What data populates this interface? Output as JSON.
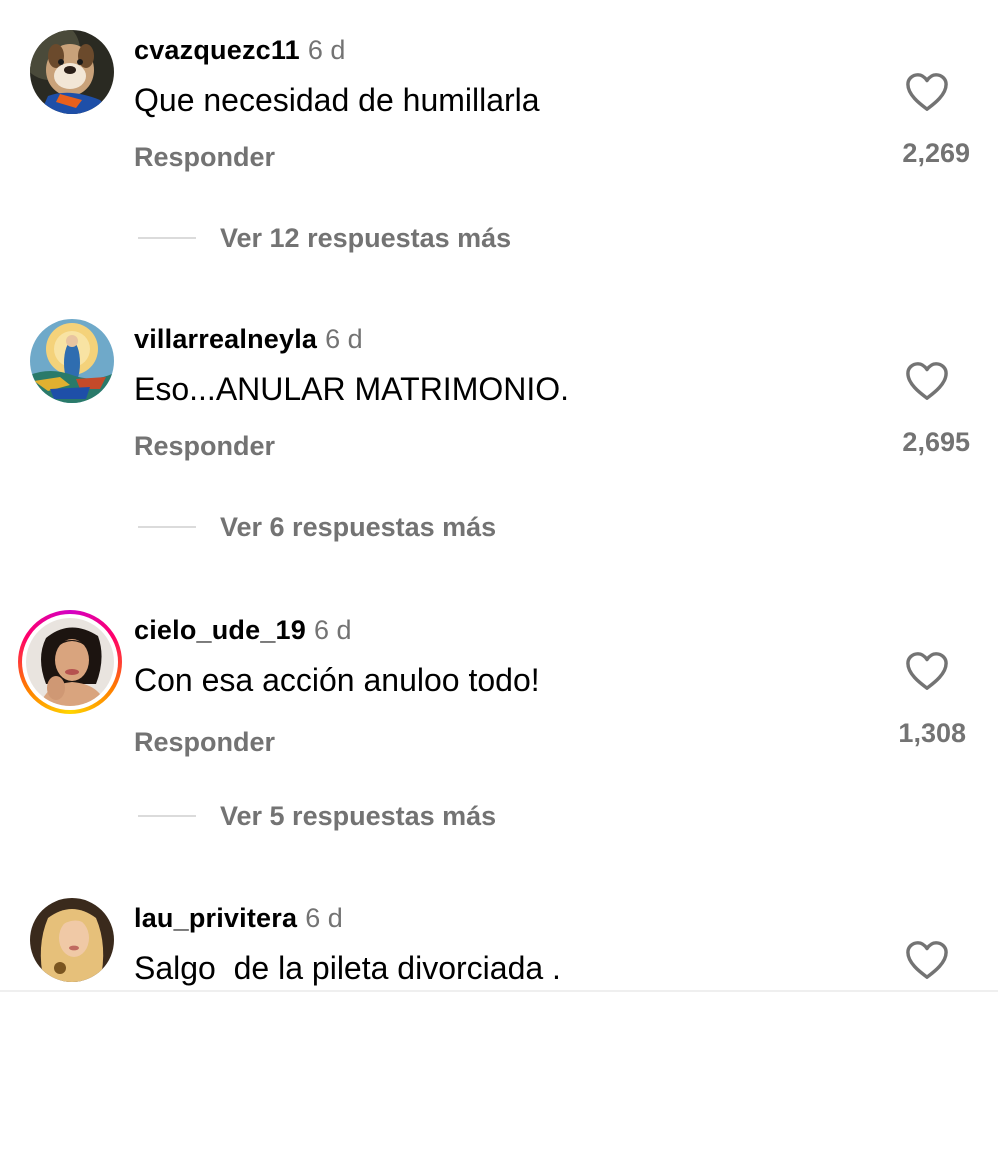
{
  "comments": [
    {
      "username": "cvazquezc11",
      "time": "6 d",
      "text": "Que necesidad de humillarla",
      "reply_label": "Responder",
      "likes": "2,269",
      "view_replies": "Ver 12 respuestas más",
      "avatar_icon": "bulldog-avatar",
      "has_story_ring": false
    },
    {
      "username": "villarrealneyla",
      "time": "6 d",
      "text": "Eso...ANULAR MATRIMONIO.",
      "reply_label": "Responder",
      "likes": "2,695",
      "view_replies": "Ver 6 respuestas más",
      "avatar_icon": "religious-art-avatar",
      "has_story_ring": false
    },
    {
      "username": "cielo_ude_19",
      "time": "6 d",
      "text": "Con esa acción anuloo todo!",
      "reply_label": "Responder",
      "likes": "1,308",
      "view_replies": "Ver 5 respuestas más",
      "avatar_icon": "woman-portrait-avatar",
      "has_story_ring": true
    },
    {
      "username": "lau_privitera",
      "time": "6 d",
      "text": "Salgo  de la pileta divorciada .",
      "avatar_icon": "blonde-woman-avatar",
      "has_story_ring": false
    }
  ],
  "colors": {
    "secondary_text": "#737373",
    "divider": "#dbdbdb",
    "story_ring_start": "#d300c5",
    "story_ring_end": "#ffd600"
  }
}
